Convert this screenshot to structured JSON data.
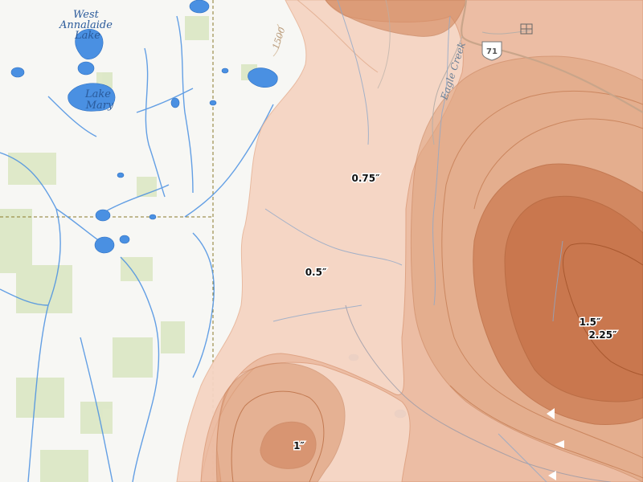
{
  "lakes": {
    "west_annalaide": [
      "West",
      "Annalaide",
      "Lake"
    ],
    "mary": [
      "Lake",
      "Mary"
    ]
  },
  "contour_label": "1500",
  "creek_label": "Eagle Creek",
  "highway_shield": "71",
  "precip_labels": {
    "l075": "0.75″",
    "l05": "0.5″",
    "l1": "1″",
    "l15": "1.5″",
    "l225": "2.25″"
  },
  "colors": {
    "precip_light": "#f4cdb8",
    "precip_mid": "#e3a07c",
    "precip_dark": "#c9744a",
    "water": "#4a90e2",
    "vegetation": "#d9e6c2"
  }
}
